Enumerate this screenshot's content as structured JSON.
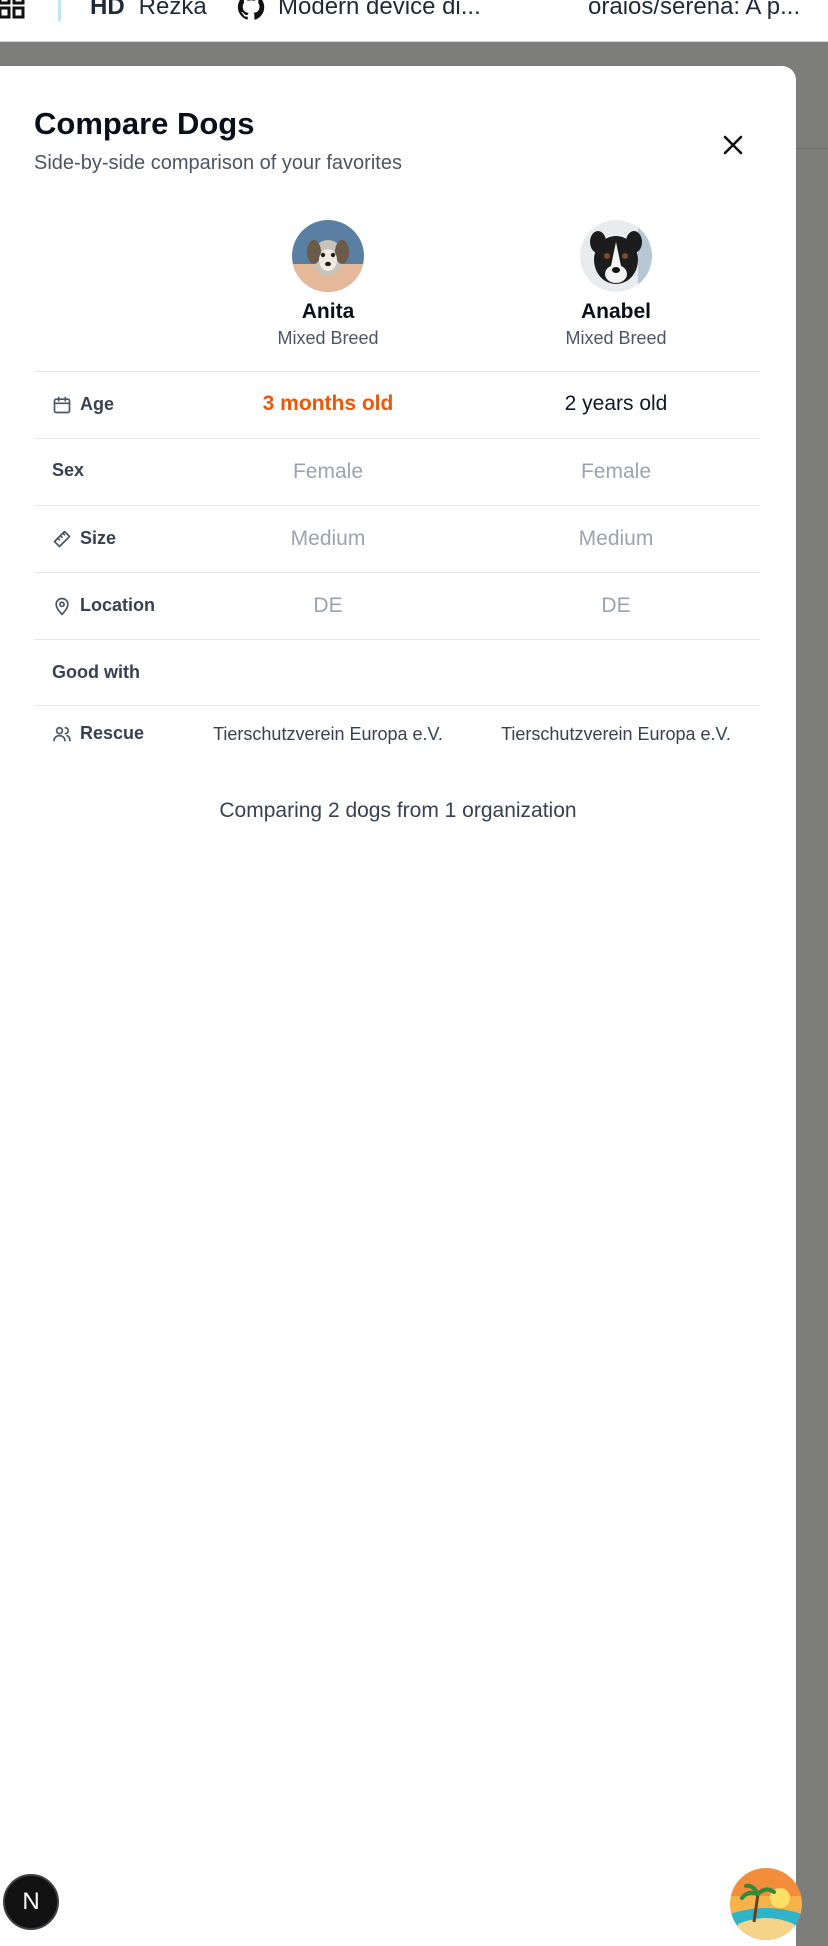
{
  "browser": {
    "apps_icon": "apps-grid-icon",
    "bookmarks": [
      {
        "badge": "HD",
        "label": "Rezka"
      },
      {
        "icon": "github-icon",
        "label": "Modern device di..."
      },
      {
        "label": "oraios/serena: A p..."
      }
    ]
  },
  "modal": {
    "title": "Compare Dogs",
    "subtitle": "Side-by-side comparison of your favorites",
    "close_icon": "close-icon",
    "dogs": [
      {
        "name": "Anita",
        "breed": "Mixed Breed"
      },
      {
        "name": "Anabel",
        "breed": "Mixed Breed"
      }
    ],
    "rows": {
      "age": {
        "label": "Age",
        "icon": "calendar-icon",
        "values": [
          "3 months old",
          "2 years old"
        ]
      },
      "sex": {
        "label": "Sex",
        "values": [
          "Female",
          "Female"
        ]
      },
      "size": {
        "label": "Size",
        "icon": "ruler-icon",
        "values": [
          "Medium",
          "Medium"
        ]
      },
      "location": {
        "label": "Location",
        "icon": "map-pin-icon",
        "values": [
          "DE",
          "DE"
        ]
      },
      "good_with": {
        "label": "Good with"
      },
      "rescue": {
        "label": "Rescue",
        "icon": "users-icon",
        "values": [
          "Tierschutzverein Europa e.V.",
          "Tierschutzverein Europa e.V."
        ]
      }
    },
    "footer": "Comparing 2 dogs from 1 organization"
  },
  "overlays": {
    "next_badge": "N"
  },
  "colors": {
    "accent_orange": "#ea580c",
    "muted_gray": "#9ca3af",
    "backdrop": "#7d7d7b"
  }
}
